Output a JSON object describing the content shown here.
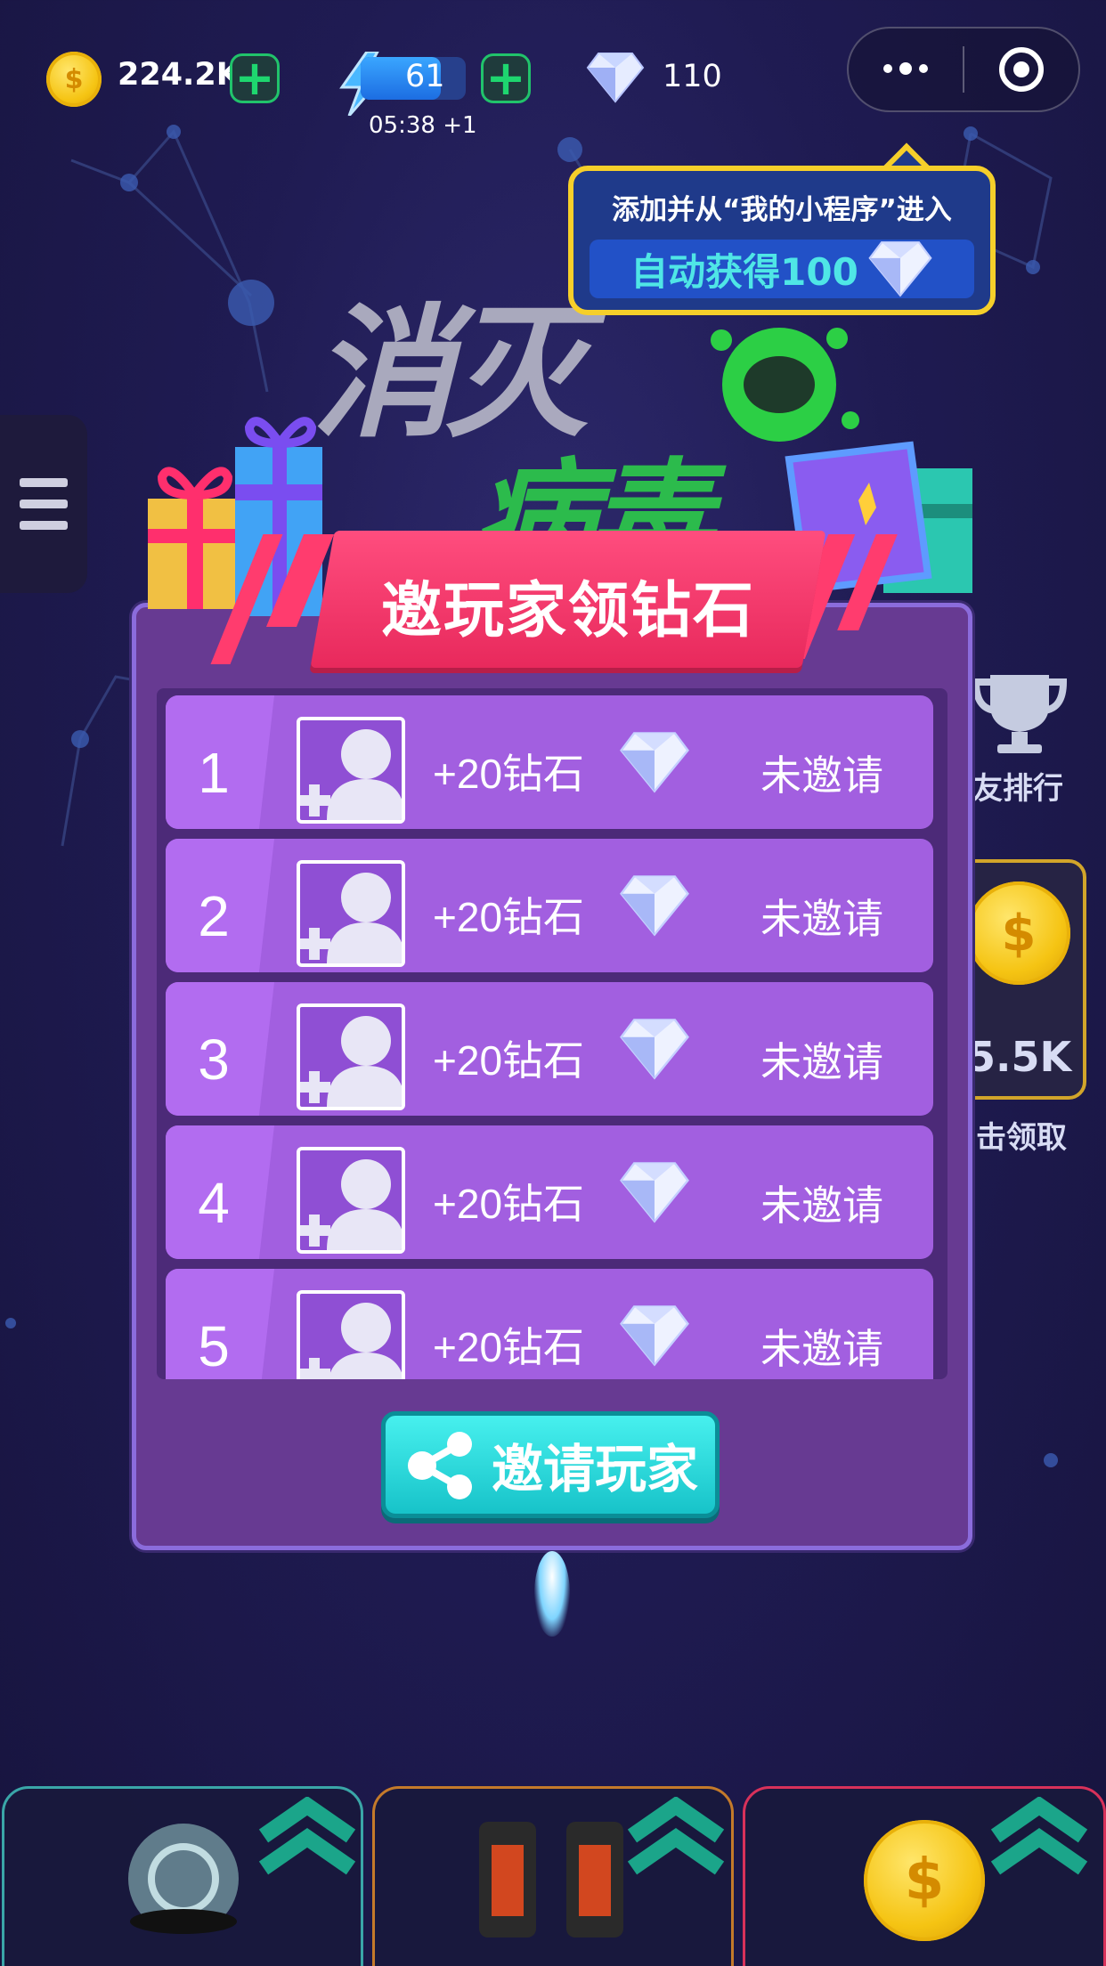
{
  "topbar": {
    "coins": "224.2K",
    "coin_symbol": "$",
    "energy": "61",
    "energy_timer": "05:38 +1",
    "diamonds": "110"
  },
  "tooltip": {
    "line1": "添加并从“我的小程序”进入",
    "line2": "自动获得100"
  },
  "dialog": {
    "title": "邀玩家领钻石",
    "invite_button": "邀请玩家",
    "rows": [
      {
        "num": "1",
        "reward": "+20钻石",
        "status": "未邀请"
      },
      {
        "num": "2",
        "reward": "+20钻石",
        "status": "未邀请"
      },
      {
        "num": "3",
        "reward": "+20钻石",
        "status": "未邀请"
      },
      {
        "num": "4",
        "reward": "+20钻石",
        "status": "未邀请"
      },
      {
        "num": "5",
        "reward": "+20钻石",
        "status": "未邀请"
      }
    ]
  },
  "background": {
    "logo_top": "消灭",
    "logo_bottom": "病毒",
    "side_rank_label": "友排行",
    "side_coin_value": "5.5K",
    "side_coin_label": "击领取"
  },
  "colors": {
    "dialog": "#673a92",
    "row": "#a25fe0",
    "ribbon": "#e8295c",
    "invite": "#17c3c9",
    "tooltip_border": "#f6cf2a"
  }
}
